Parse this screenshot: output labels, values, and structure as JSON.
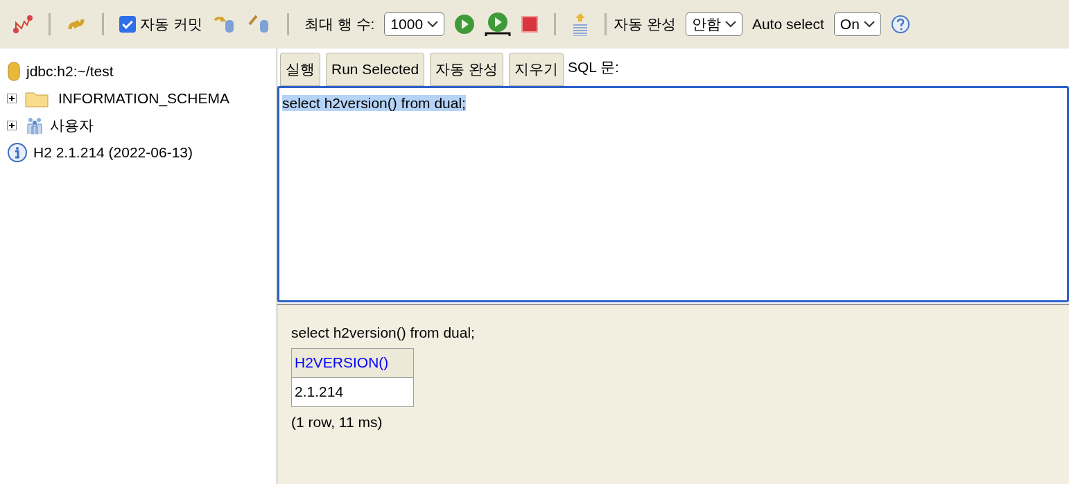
{
  "toolbar": {
    "auto_commit": {
      "label": "자동 커밋",
      "checked": true
    },
    "max_rows": {
      "label": "최대 행 수:",
      "value": "1000"
    },
    "auto_complete": {
      "label": "자동 완성",
      "value": "안함"
    },
    "auto_select": {
      "label": "Auto select",
      "value": "On"
    }
  },
  "tree": [
    {
      "kind": "database",
      "label": "jdbc:h2:~/test"
    },
    {
      "kind": "folder",
      "label": "INFORMATION_SCHEMA",
      "expanded": false
    },
    {
      "kind": "users",
      "label": "사용자",
      "expanded": false
    },
    {
      "kind": "info",
      "label": "H2 2.1.214 (2022-06-13)"
    }
  ],
  "editor_buttons": [
    "실행",
    "Run Selected",
    "자동 완성",
    "지우기"
  ],
  "editor_label": "SQL 문:",
  "editor": {
    "value": "select h2version() from dual;",
    "text_selected": true
  },
  "result": {
    "query": "select h2version() from dual;",
    "columns": [
      "H2VERSION()"
    ],
    "rows": [
      [
        "2.1.214"
      ]
    ],
    "summary": "(1 row, 11 ms)"
  }
}
